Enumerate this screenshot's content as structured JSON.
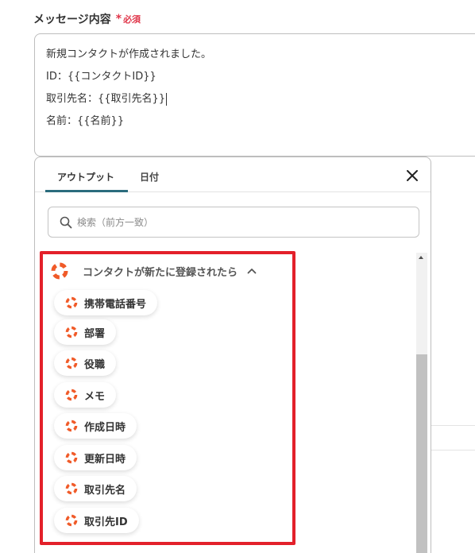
{
  "field": {
    "label": "メッセージ内容",
    "required_star": "*",
    "required_text": "必須"
  },
  "message": {
    "lines": [
      "新規コンタクトが作成されました。",
      "ID：{{コンタクトID}}",
      "取引先名：{{取引先名}}",
      "名前：{{名前}}"
    ]
  },
  "panel": {
    "tabs": [
      "アウトプット",
      "日付"
    ],
    "active_tab": 0,
    "search_placeholder": "検索（前方一致）",
    "group_title": "コンタクトが新たに登録されたら",
    "items": [
      "携帯電話番号",
      "部署",
      "役職",
      "メモ",
      "作成日時",
      "更新日時",
      "取引先名",
      "取引先ID"
    ]
  },
  "colors": {
    "accent_tab": "#2b6c7d",
    "required": "#e0364a",
    "highlight": "#e3202a",
    "icon": "#f05a28"
  },
  "icons": {
    "close": "close-icon",
    "search": "search-icon",
    "app": "lifebuoy-icon",
    "chevron": "chevron-up-icon"
  }
}
